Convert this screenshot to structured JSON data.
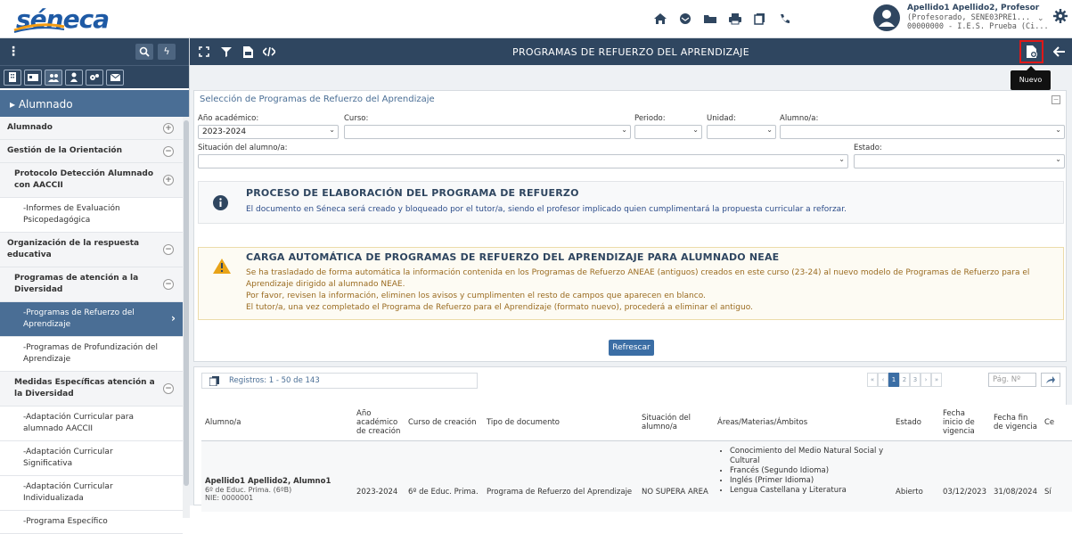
{
  "app": {
    "logo_text": "séneca",
    "brand_color": "#1e5aa5",
    "header_color": "#2f4660",
    "accent_color": "#4a6e95"
  },
  "user": {
    "line1": "Apellido1 Apellido2, Profesor",
    "line2": "(Profesorado, SENE03PRE1...",
    "line3": "00000000 - I.E.S. Prueba (Ci..."
  },
  "top_icons": [
    "home-icon",
    "mail-icon",
    "folder-icon",
    "print-icon",
    "copy-icon",
    "phone-icon"
  ],
  "sidebar": {
    "section_title": "▸ Alumnado",
    "items": [
      {
        "label": "Alumnado",
        "kind": "grp",
        "toggle": "+"
      },
      {
        "label": "Gestión de la Orientación",
        "kind": "grp",
        "toggle": "−"
      },
      {
        "label": "Protocolo Detección Alumnado con AACCII",
        "kind": "grp sub",
        "toggle": "+"
      },
      {
        "label": "-Informes de Evaluación Psicopedagógica",
        "kind": "leaf",
        "toggle": ""
      },
      {
        "label": "Organización de la respuesta educativa",
        "kind": "grp",
        "toggle": "−"
      },
      {
        "label": "Programas de atención a la Diversidad",
        "kind": "grp sub",
        "toggle": "−"
      },
      {
        "label": "-Programas de Refuerzo del Aprendizaje",
        "kind": "leaf active",
        "toggle": ""
      },
      {
        "label": "-Programas de Profundización del Aprendizaje",
        "kind": "leaf",
        "toggle": ""
      },
      {
        "label": "Medidas Específicas atención a la Diversidad",
        "kind": "grp sub",
        "toggle": "−"
      },
      {
        "label": "-Adaptación Curricular para alumnado AACCII",
        "kind": "leaf",
        "toggle": ""
      },
      {
        "label": "-Adaptación Curricular Significativa",
        "kind": "leaf",
        "toggle": ""
      },
      {
        "label": "-Adaptación Curricular Individualizada",
        "kind": "leaf",
        "toggle": ""
      },
      {
        "label": "-Programa Específico",
        "kind": "leaf",
        "toggle": ""
      }
    ]
  },
  "main": {
    "title": "PROGRAMAS DE REFUERZO DEL APRENDIZAJE",
    "new_tooltip": "Nuevo",
    "filter_panel_title": "Selección de Programas de Refuerzo del Aprendizaje",
    "filters": {
      "anio_label": "Año académico:",
      "anio_value": "2023-2024",
      "curso_label": "Curso:",
      "curso_value": "",
      "periodo_label": "Periodo:",
      "periodo_value": "",
      "unidad_label": "Unidad:",
      "unidad_value": "",
      "alumno_label": "Alumno/a:",
      "alumno_value": "",
      "situacion_label": "Situación del alumno/a:",
      "situacion_value": "",
      "estado_label": "Estado:",
      "estado_value": ""
    },
    "info": {
      "heading": "PROCESO DE ELABORACIÓN DEL PROGRAMA DE REFUERZO",
      "text": "El documento en Séneca será creado y bloqueado por el tutor/a, siendo el profesor implicado quien cumplimentará la propuesta curricular a reforzar."
    },
    "warning": {
      "heading": "CARGA AUTOMÁTICA DE PROGRAMAS DE REFUERZO DEL APRENDIZAJE PARA ALUMNADO NEAE",
      "line1": "Se ha trasladado de forma automática la información contenida en los Programas de Refuerzo ANEAE (antiguos) creados en este curso (23-24) al nuevo modelo de Programas de Refuerzo para el",
      "line2": "Aprendizaje dirigido al alumnado NEAE.",
      "line3": "Por favor, revisen la información, eliminen los avisos y cumplimenten el resto de campos que aparecen en blanco.",
      "line4": "El tutor/a, una vez completado el Programa de Refuerzo para el Aprendizaje (formato nuevo), procederá a eliminar el antiguo."
    },
    "refresh_label": "Refrescar",
    "records": "Registros: 1 - 50 de 143",
    "pager": {
      "pages": [
        "«",
        "‹",
        "1",
        "2",
        "3",
        "›",
        "»"
      ],
      "page_placeholder": "Pág. Nº"
    },
    "table": {
      "headers": [
        "Alumno/a",
        "Año académico de creación",
        "Curso de creación",
        "Tipo de documento",
        "Situación del alumno/a",
        "Áreas/Materias/Ámbitos",
        "Estado",
        "Fecha inicio de vigencia",
        "Fecha fin de vigencia",
        "Ce"
      ],
      "row": {
        "name": "Apellido1 Apellido2, Alumno1",
        "course": "6º de Educ. Prima. (6ºB)",
        "nie": "NIE: 0000001",
        "anio": "2023-2024",
        "curso": "6º de Educ. Prima.",
        "tipo": "Programa de Refuerzo del Aprendizaje",
        "situacion": "NO SUPERA AREA",
        "areas": [
          "Conocimiento del Medio Natural Social y Cultural",
          "Francés (Segundo Idioma)",
          "Inglés (Primer Idioma)",
          "Lengua Castellana y Literatura"
        ],
        "estado": "Abierto",
        "inicio": "03/12/2023",
        "fin": "31/08/2024",
        "ce": "Sí"
      }
    }
  }
}
